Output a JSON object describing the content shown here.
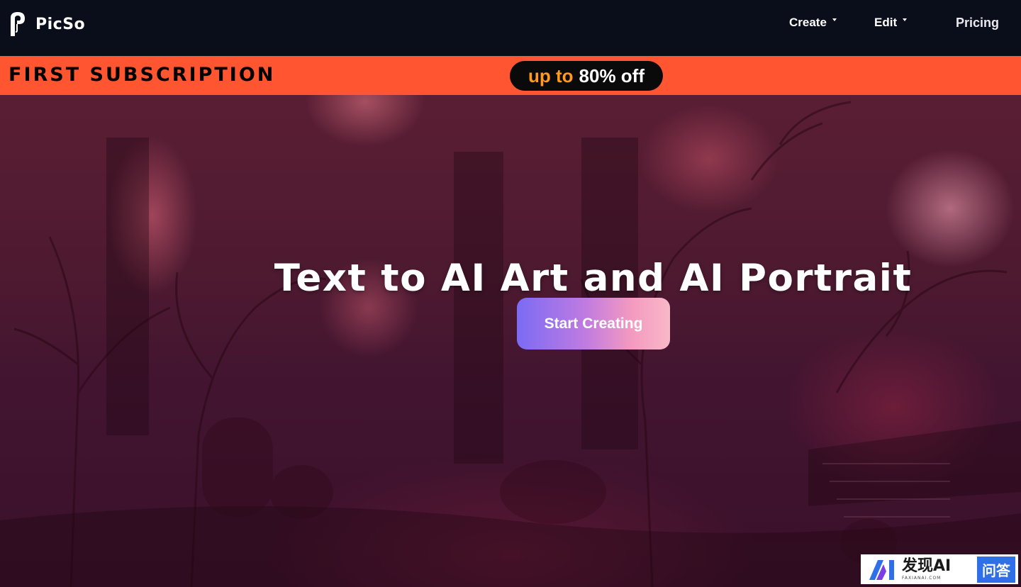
{
  "navbar": {
    "brand_name": "PicSo",
    "items": [
      {
        "label": "Create",
        "has_dropdown": true
      },
      {
        "label": "Edit",
        "has_dropdown": true
      },
      {
        "label": "Pricing",
        "has_dropdown": false
      }
    ]
  },
  "promo": {
    "left_text": "FIRST SUBSCRIPTION",
    "pill_part1": "up to",
    "pill_part2": "80% off"
  },
  "hero": {
    "title": "Text to AI Art and AI Portrait",
    "cta_label": "Start Creating"
  },
  "watermark": {
    "main": "发现AI",
    "sub": "FAXIANAI.COM",
    "badge": "问答"
  },
  "colors": {
    "navbar_bg": "#0a0e1a",
    "promo_bg": "#ff5530",
    "promo_accent": "#ff9a1a",
    "cta_gradient_start": "#7b6bf5",
    "cta_gradient_end": "#f9b8c8"
  },
  "icons": {
    "brand": "picso-logo-icon",
    "dropdown": "caret-down-icon"
  }
}
